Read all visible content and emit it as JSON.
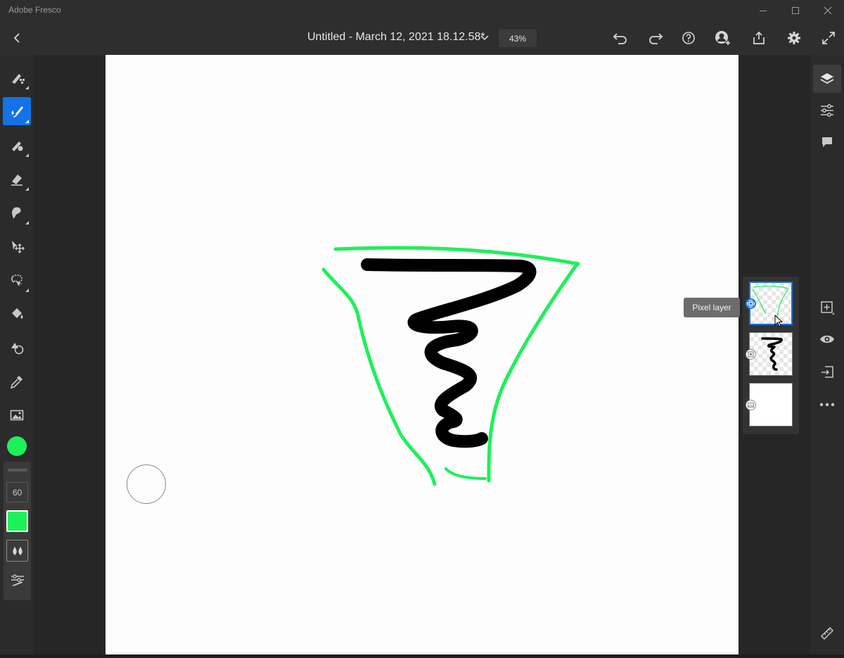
{
  "app": {
    "title": "Adobe Fresco"
  },
  "toolbar": {
    "document_title": "Untitled - March 12, 2021 18.12.58*",
    "zoom": "43%"
  },
  "left_tools": [
    {
      "name": "pixel-brush-tool",
      "icon": "pixel-brush-icon"
    },
    {
      "name": "live-brush-tool",
      "icon": "live-brush-icon",
      "active": true
    },
    {
      "name": "vector-brush-tool",
      "icon": "vector-brush-icon"
    },
    {
      "name": "eraser-tool",
      "icon": "eraser-icon"
    },
    {
      "name": "smudge-tool",
      "icon": "smudge-icon"
    },
    {
      "name": "move-tool",
      "icon": "move-icon"
    },
    {
      "name": "lasso-tool",
      "icon": "lasso-icon"
    },
    {
      "name": "fill-tool",
      "icon": "paint-bucket-icon"
    },
    {
      "name": "shape-tool",
      "icon": "shape-icon"
    },
    {
      "name": "eyedropper-tool",
      "icon": "eyedropper-icon"
    },
    {
      "name": "place-image-tool",
      "icon": "image-icon"
    }
  ],
  "brush": {
    "color": "#1ef05a",
    "size": "60"
  },
  "layers_panel": {
    "tooltip": "Pixel layer",
    "layers": [
      {
        "type": "pixel",
        "selected": true
      },
      {
        "type": "pixel",
        "selected": false
      },
      {
        "type": "background",
        "selected": false
      }
    ]
  },
  "colors": {
    "accent": "#1473e6",
    "stroke_green": "#1ef05a",
    "stroke_black": "#000000"
  }
}
